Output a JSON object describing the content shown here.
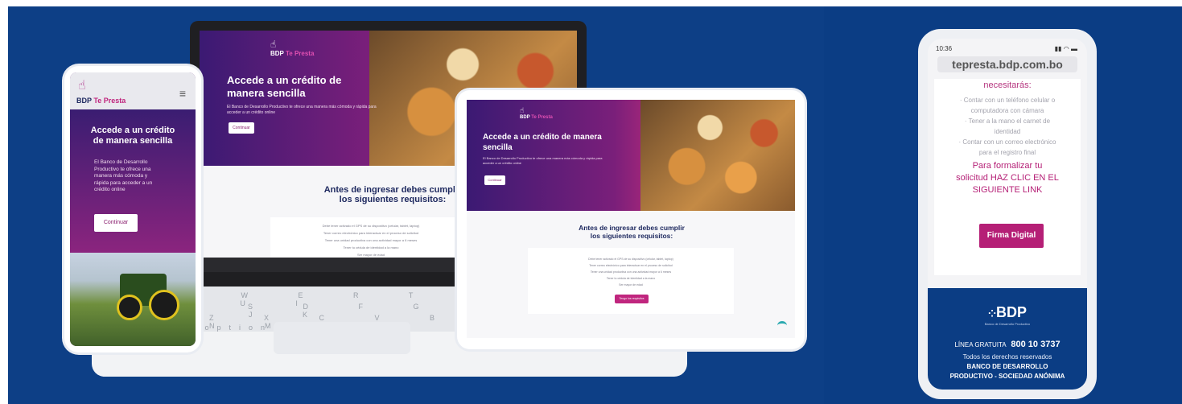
{
  "brand": {
    "bdp": "BDP",
    "te_presta": "Te Presta"
  },
  "hero": {
    "title": "Accede a un crédito de manera sencilla",
    "text": "El Banco de Desarrollo Productivo te ofrece una manera más cómoda y rápida para acceder a un crédito online",
    "button": "Continuar"
  },
  "requirements": {
    "title_l1": "Antes de ingresar debes cumplir",
    "title_l2": "los siguientes requisitos:",
    "items": [
      "Debe tener activado el GPS de su dispositivo (celular, tablet, laptop)",
      "Tener correo electrónico para interactuar en el proceso de solicitud",
      "Tener una unidad productiva con una actividad mayor a 6 meses",
      "Tener tu cédula de identidad a la mano",
      "Ser mayor de edad"
    ],
    "button": "Tengo los requisitos"
  },
  "mobile_left": {
    "title_l1": "Accede a un crédito",
    "title_l2": "de manera sencilla",
    "text_lines": [
      "El Banco de Desarrollo",
      "Productivo te ofrece una",
      "manera más cómoda y",
      "rápida para acceder a un",
      "crédito online"
    ],
    "button": "Continuar"
  },
  "keyboard": {
    "row1": "Q W E R T Y U I",
    "row2": "A S D F G H J K",
    "row3": "Z X C V B N M",
    "row4": "ctrl option cmd"
  },
  "phone_right": {
    "time": "10:36",
    "url": "tepresta.bdp.com.bo",
    "heading_partial": "necesitarás:",
    "list": [
      "· Contar con un teléfono celular o",
      "computadora con cámara",
      "· Tener a la mano el carnet de",
      "identidad",
      "· Contar con un correo electrónico",
      "para el registro final"
    ],
    "cta_l1": "Para formalizar tu",
    "cta_l2": "solicitud HAZ CLIC EN EL",
    "cta_l3": "SIGUIENTE LINK",
    "button": "Firma Digital",
    "footer_logo": "BDP",
    "footer_logo_sub": "Banco de Desarrollo Productivo",
    "linea_label": "LÍNEA GRATUITA",
    "linea_number": "800 10 3737",
    "rights": "Todos los derechos reservados",
    "company_l1": "BANCO DE DESARROLLO",
    "company_l2": "PRODUCTIVO - SOCIEDAD ANÓNIMA"
  },
  "colors": {
    "background": "#0d3f86",
    "brand_pink": "#c0267e",
    "hero_purple": "#3b1a73"
  }
}
